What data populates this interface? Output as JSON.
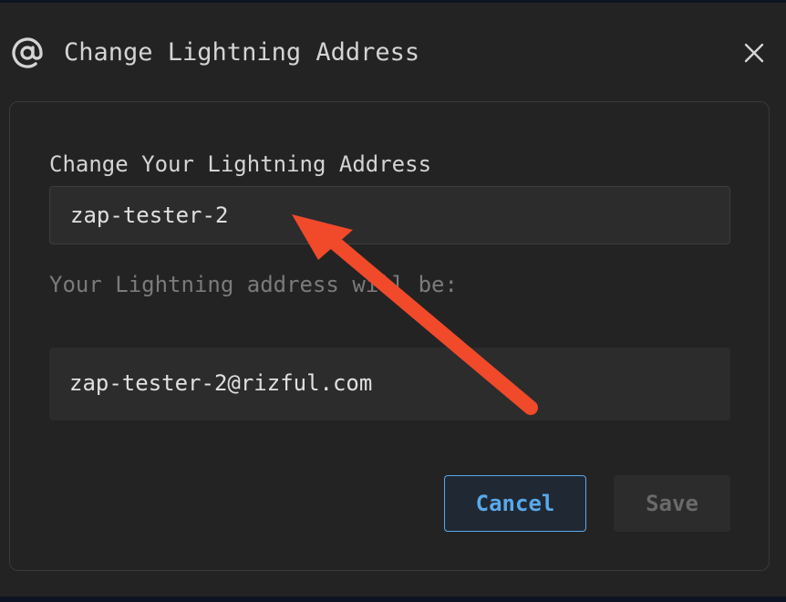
{
  "dialog": {
    "title": "Change Lightning Address",
    "icon": "at-sign-icon",
    "close_icon": "close-icon"
  },
  "form": {
    "label": "Change Your Lightning Address",
    "input_value": "zap-tester-2",
    "hint": "Your Lightning address will be:",
    "address_preview": "zap-tester-2@rizful.com"
  },
  "actions": {
    "cancel_label": "Cancel",
    "save_label": "Save"
  },
  "colors": {
    "background": "#232323",
    "accent": "#5aa8ea",
    "annotation_arrow": "#f04a2a"
  }
}
